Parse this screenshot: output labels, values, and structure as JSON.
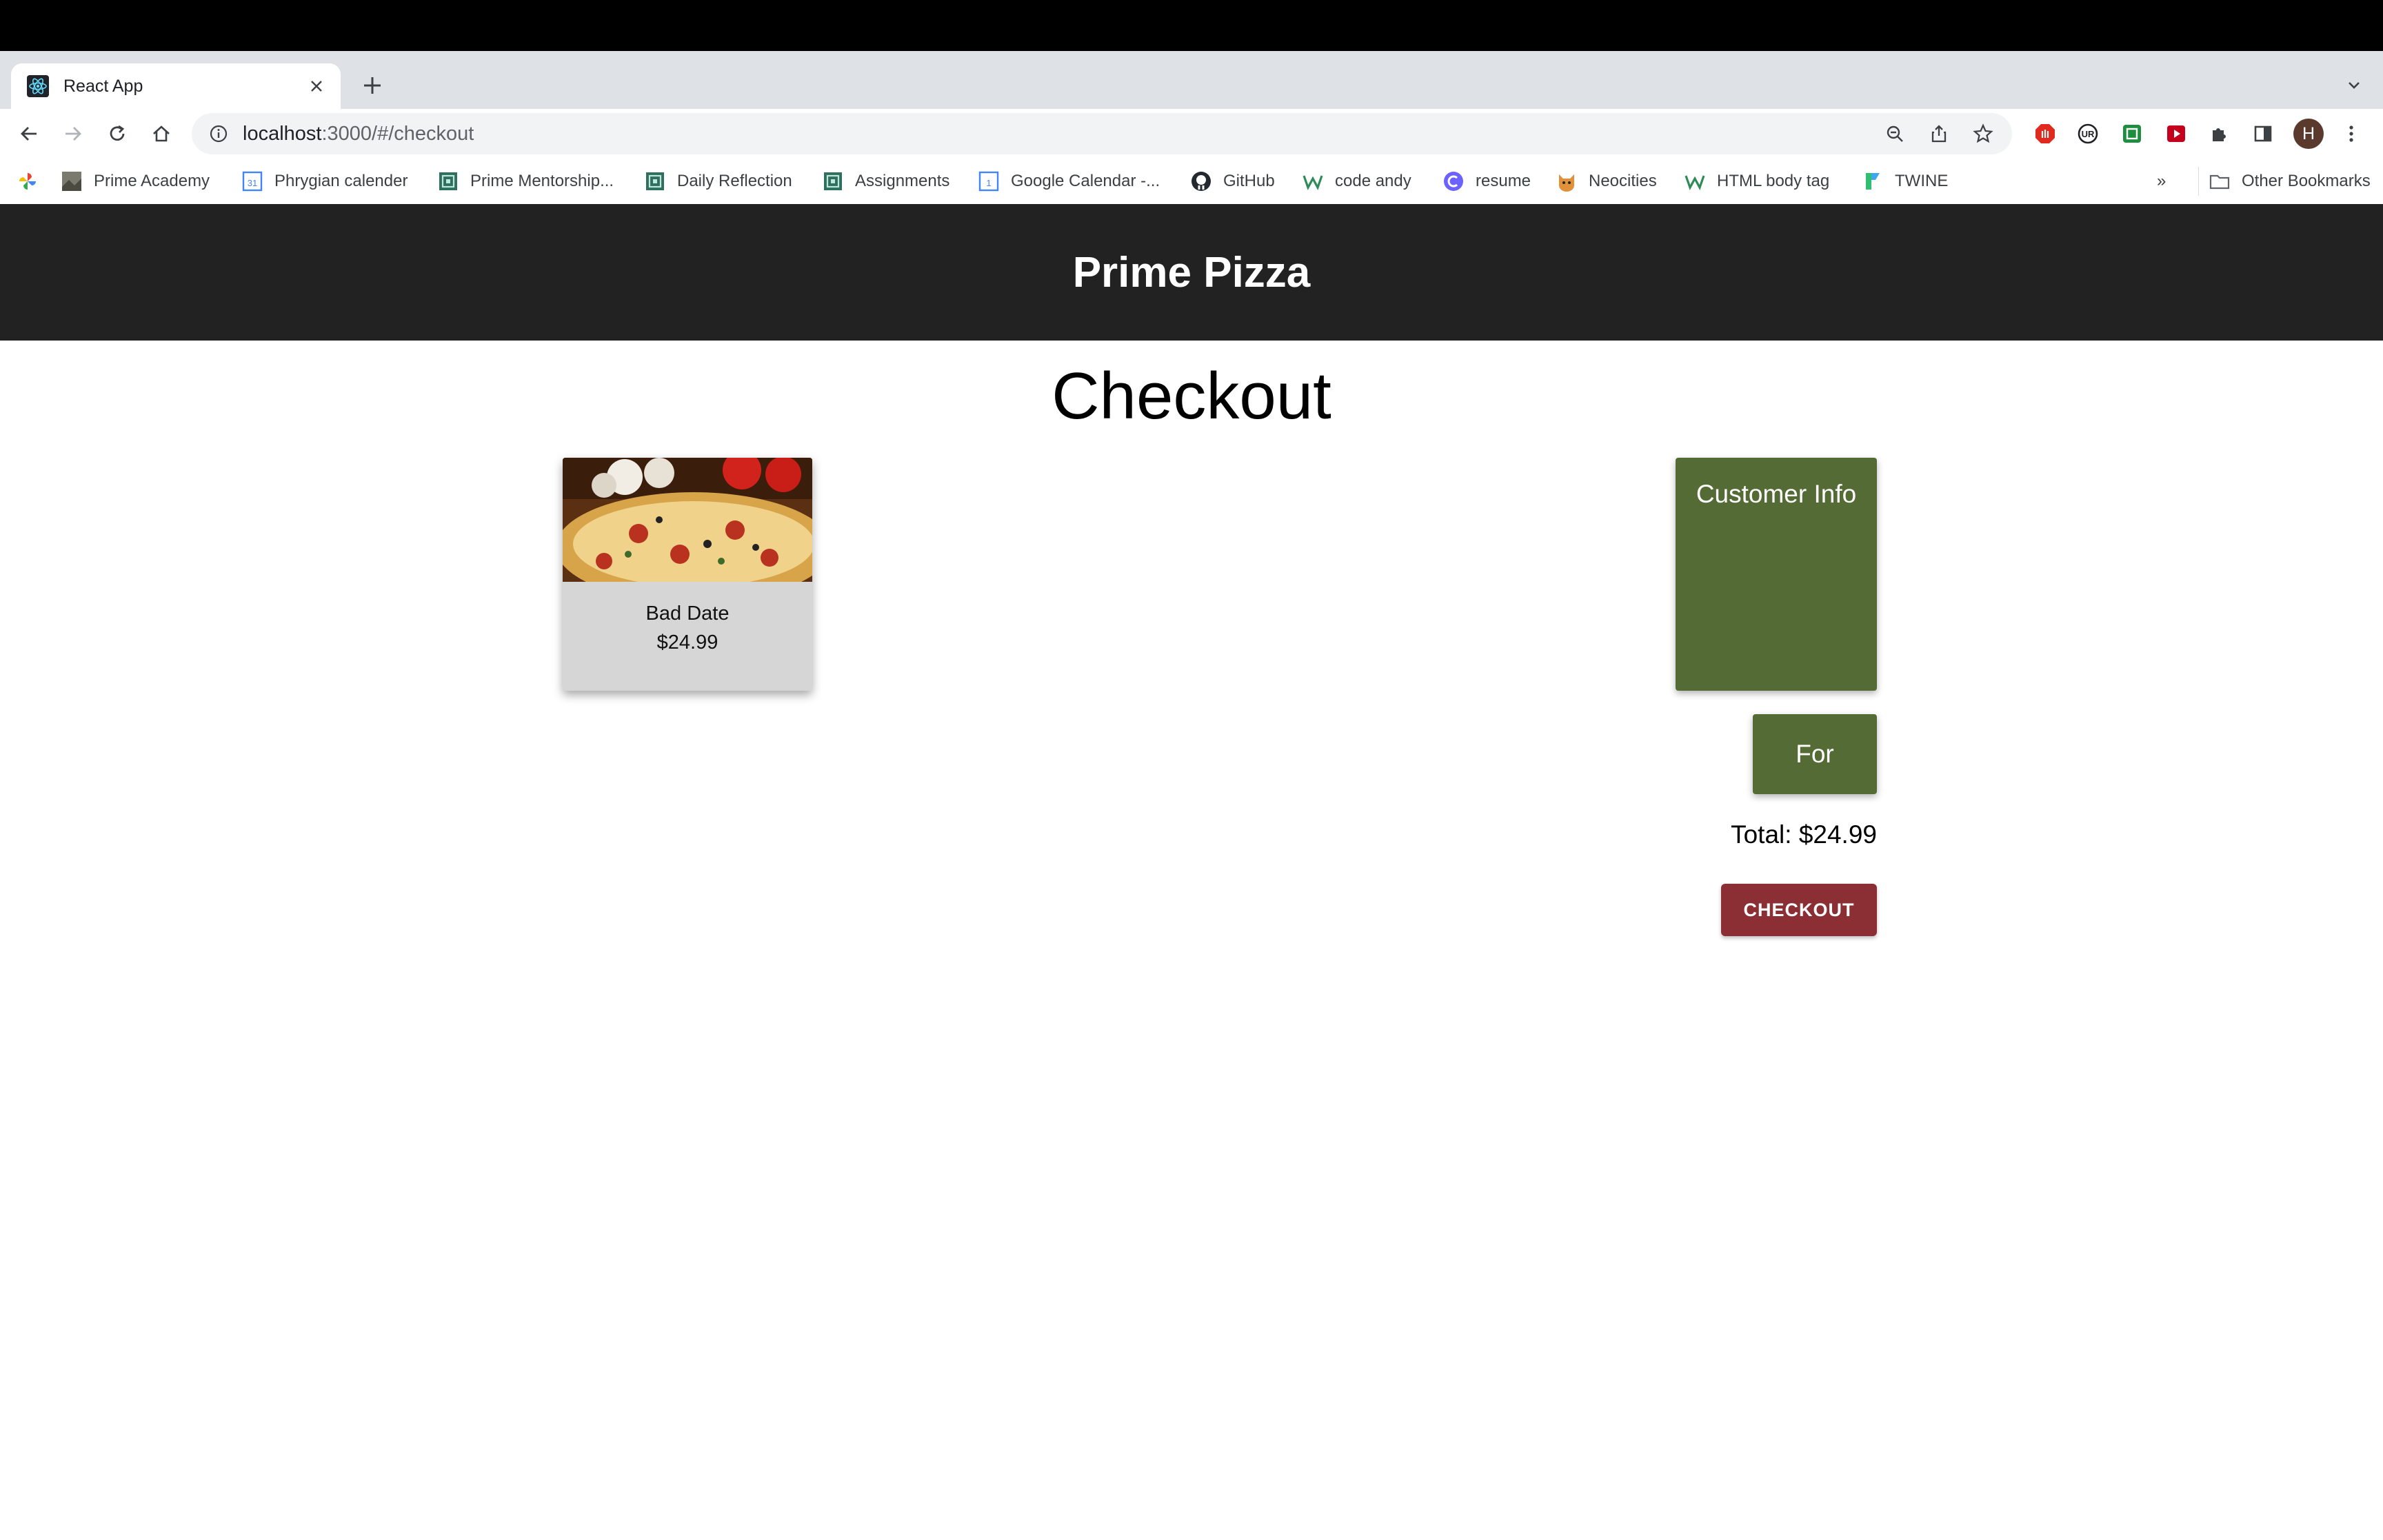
{
  "browser": {
    "tab_title": "React App",
    "url_host": "localhost",
    "url_rest": ":3000/#/checkout",
    "avatar_initial": "H",
    "bookmarks": [
      {
        "label": "Prime Academy",
        "icon": "photo-icon"
      },
      {
        "label": "Phrygian calender",
        "icon": "calendar-icon"
      },
      {
        "label": "Prime Mentorship...",
        "icon": "maze-icon"
      },
      {
        "label": "Daily Reflection",
        "icon": "maze-icon"
      },
      {
        "label": "Assignments",
        "icon": "maze-icon"
      },
      {
        "label": "Google Calendar -...",
        "icon": "calendar-icon"
      },
      {
        "label": "GitHub",
        "icon": "github-icon"
      },
      {
        "label": "code andy",
        "icon": "w-icon"
      },
      {
        "label": "resume",
        "icon": "c-icon"
      },
      {
        "label": "Neocities",
        "icon": "cat-icon"
      },
      {
        "label": "HTML body tag",
        "icon": "w-icon"
      },
      {
        "label": "TWINE",
        "icon": "twine-icon"
      }
    ],
    "overflow_label": "»",
    "other_bookmarks": "Other Bookmarks"
  },
  "app": {
    "brand": "Prime Pizza",
    "page_title": "Checkout",
    "item": {
      "name": "Bad Date",
      "price": "$24.99"
    },
    "customer_info_label": "Customer Info",
    "for_label": "For",
    "total_label": "Total: $24.99",
    "checkout_button": "CHECKOUT"
  },
  "colors": {
    "header_bg": "#222222",
    "panel_green": "#556b35",
    "checkout_red": "#8b2f35",
    "card_bg": "#d6d6d6"
  }
}
